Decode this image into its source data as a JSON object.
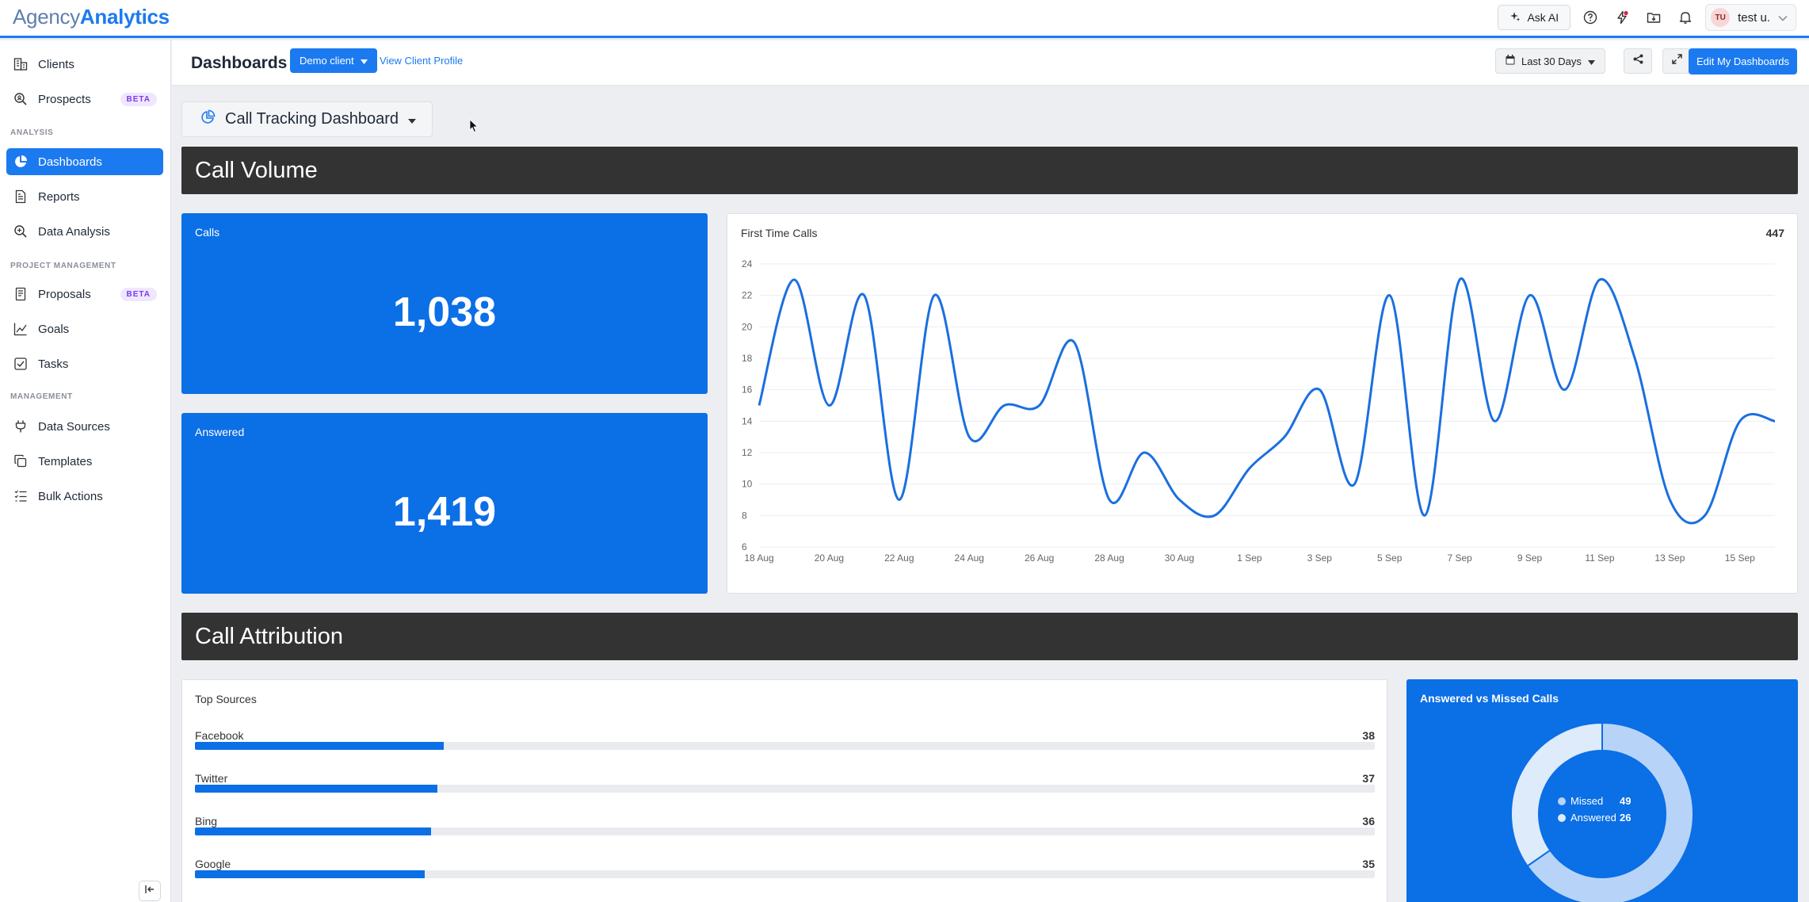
{
  "app": {
    "logo_part1": "Agency",
    "logo_part2": "Analytics"
  },
  "topbar": {
    "ask_ai_label": "Ask AI",
    "user_initials": "TU",
    "user_name": "test u."
  },
  "sidebar": {
    "items_top": [
      {
        "label": "Clients",
        "icon": "clients-icon"
      },
      {
        "label": "Prospects",
        "icon": "search-icon",
        "badge": "BETA"
      }
    ],
    "section_analysis": "ANALYSIS",
    "items_analysis": [
      {
        "label": "Dashboards",
        "icon": "pie-chart-icon",
        "active": true
      },
      {
        "label": "Reports",
        "icon": "document-icon"
      },
      {
        "label": "Data Analysis",
        "icon": "zoom-icon"
      }
    ],
    "section_project": "PROJECT MANAGEMENT",
    "items_project": [
      {
        "label": "Proposals",
        "icon": "proposal-icon",
        "badge": "BETA"
      },
      {
        "label": "Goals",
        "icon": "trend-icon"
      },
      {
        "label": "Tasks",
        "icon": "checkbox-icon"
      }
    ],
    "section_management": "MANAGEMENT",
    "items_management": [
      {
        "label": "Data Sources",
        "icon": "plug-icon"
      },
      {
        "label": "Templates",
        "icon": "copy-icon"
      },
      {
        "label": "Bulk Actions",
        "icon": "list-icon"
      }
    ]
  },
  "header": {
    "title": "Dashboards",
    "client_button": "Demo client",
    "view_profile": "View Client Profile",
    "date_range": "Last 30 Days",
    "edit_button": "Edit My Dashboards"
  },
  "dashboard_selector": "Call Tracking Dashboard",
  "sections": {
    "call_volume": "Call Volume",
    "call_attribution": "Call Attribution"
  },
  "stats": {
    "calls_label": "Calls",
    "calls_value": "1,038",
    "answered_label": "Answered",
    "answered_value": "1,419"
  },
  "first_time_calls": {
    "title": "First Time Calls",
    "total": "447"
  },
  "top_sources": {
    "title": "Top Sources",
    "max": 180,
    "items": [
      {
        "name": "Facebook",
        "value": 38
      },
      {
        "name": "Twitter",
        "value": 37
      },
      {
        "name": "Bing",
        "value": 36
      },
      {
        "name": "Google",
        "value": 35
      }
    ]
  },
  "answered_missed": {
    "title": "Answered vs Missed Calls",
    "legend": [
      {
        "label": "Missed",
        "value": "49"
      },
      {
        "label": "Answered",
        "value": "26"
      }
    ]
  },
  "colors": {
    "accent": "#1c7af0",
    "card_blue": "#0b6fe6",
    "banner": "#333333",
    "line": "#1a6fe0",
    "donut_missed": "#b7d4f8",
    "donut_answered": "#deebfb"
  },
  "chart_data": [
    {
      "type": "line",
      "title": "First Time Calls",
      "x": [
        "18 Aug",
        "19 Aug",
        "20 Aug",
        "21 Aug",
        "22 Aug",
        "23 Aug",
        "24 Aug",
        "25 Aug",
        "26 Aug",
        "27 Aug",
        "28 Aug",
        "29 Aug",
        "30 Aug",
        "31 Aug",
        "1 Sep",
        "2 Sep",
        "3 Sep",
        "4 Sep",
        "5 Sep",
        "6 Sep",
        "7 Sep",
        "8 Sep",
        "9 Sep",
        "10 Sep",
        "11 Sep",
        "12 Sep",
        "13 Sep",
        "14 Sep",
        "15 Sep",
        "16 Sep"
      ],
      "xticks": [
        "18 Aug",
        "20 Aug",
        "22 Aug",
        "24 Aug",
        "26 Aug",
        "28 Aug",
        "30 Aug",
        "1 Sep",
        "3 Sep",
        "5 Sep",
        "7 Sep",
        "9 Sep",
        "11 Sep",
        "13 Sep",
        "15 Sep"
      ],
      "series": [
        {
          "values": [
            15,
            23,
            15,
            22,
            9,
            22,
            13,
            15,
            15,
            19,
            9,
            12,
            9,
            8,
            11,
            13,
            16,
            10,
            22,
            8,
            23,
            14,
            22,
            16,
            23,
            18,
            9,
            8,
            14,
            14
          ]
        }
      ],
      "yticks": [
        6,
        8,
        10,
        12,
        14,
        16,
        18,
        20,
        22,
        24
      ],
      "ylim": [
        6,
        24
      ],
      "grid": true
    },
    {
      "type": "pie",
      "title": "Answered vs Missed Calls",
      "categories": [
        "Missed",
        "Answered"
      ],
      "values": [
        49,
        26
      ]
    }
  ]
}
